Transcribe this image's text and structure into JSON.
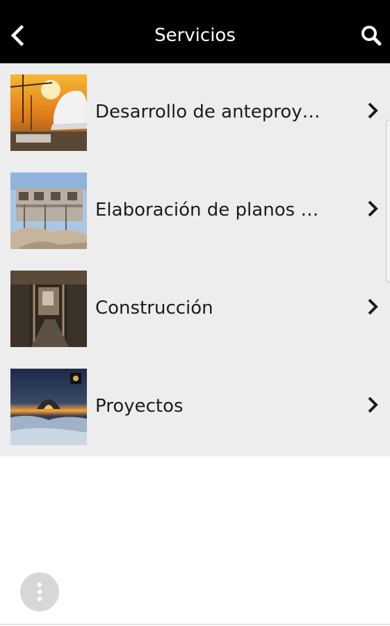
{
  "header": {
    "title": "Servicios",
    "back_icon": "chevron-left-icon",
    "search_icon": "search-icon"
  },
  "services": [
    {
      "label": "Desarrollo de anteproye...",
      "thumbnail": "construction-helmet-photo"
    },
    {
      "label": "Elaboración de planos c...",
      "thumbnail": "building-under-construction-photo"
    },
    {
      "label": "Construcción",
      "thumbnail": "construction-interior-photo"
    },
    {
      "label": "Proyectos",
      "thumbnail": "sunset-landscape-photo"
    }
  ],
  "fab": {
    "icon": "more-vertical-icon"
  },
  "colors": {
    "header_bg": "#000000",
    "list_bg": "#ededed",
    "text": "#1c1c1c",
    "fab_bg": "#d7d7d7"
  }
}
